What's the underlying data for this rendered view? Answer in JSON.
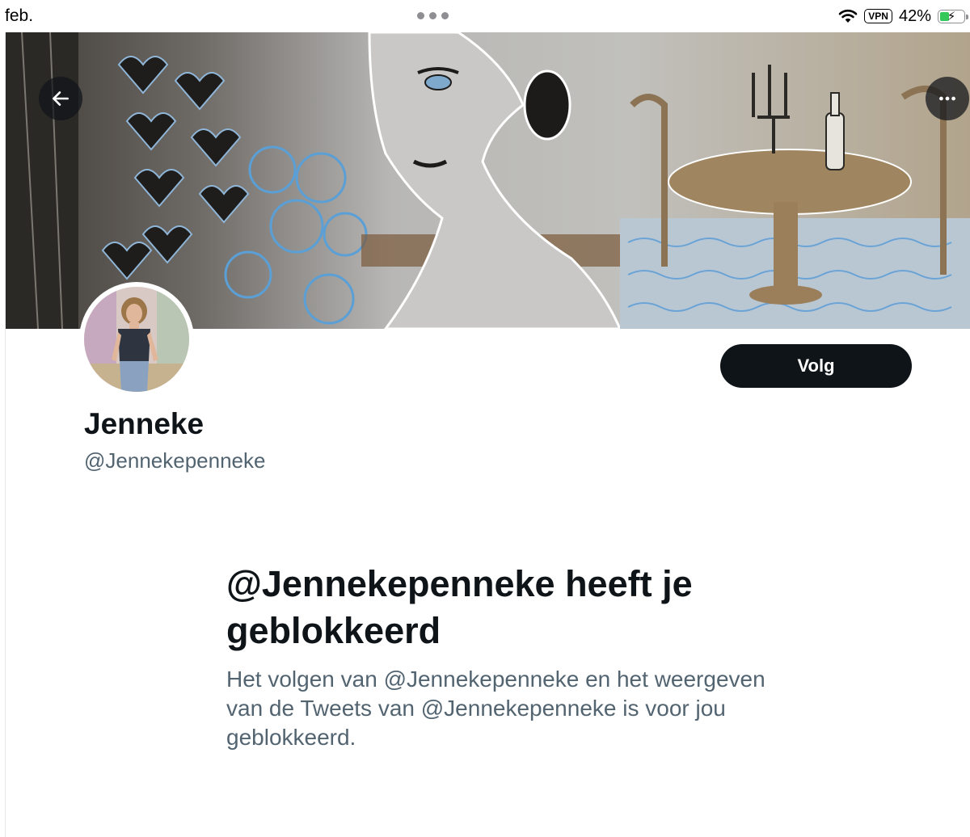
{
  "status_bar": {
    "time": "feb.",
    "vpn": "VPN",
    "battery_percent": "42%",
    "battery_level": 0.42,
    "icons": [
      "multitask-dots-icon",
      "wifi-icon",
      "battery-charging-icon"
    ]
  },
  "header": {
    "back_icon": "arrow-left-icon",
    "more_icon": "more-horizontal-icon"
  },
  "profile": {
    "display_name": "Jenneke",
    "handle": "@Jennekepenneke",
    "follow_label": "Volg"
  },
  "blocked": {
    "title": "@Jennekepenneke heeft je geblokkeerd",
    "description": "Het volgen van @Jennekepenneke en het weergeven van de Tweets van @Jennekepenneke is voor jou geblokkeerd."
  },
  "colors": {
    "primary_text": "#0f1419",
    "secondary_text": "#536471",
    "follow_button_bg": "#0f1419",
    "follow_button_text": "#ffffff",
    "battery_green": "#34c759"
  }
}
